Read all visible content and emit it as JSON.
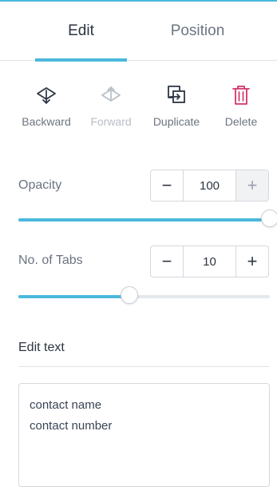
{
  "tabs": [
    {
      "label": "Edit",
      "active": true
    },
    {
      "label": "Position",
      "active": false
    }
  ],
  "toolbar": {
    "backward": {
      "label": "Backward",
      "icon": "send-backward-icon",
      "enabled": true
    },
    "forward": {
      "label": "Forward",
      "icon": "bring-forward-icon",
      "enabled": false
    },
    "duplicate": {
      "label": "Duplicate",
      "icon": "duplicate-icon",
      "enabled": true
    },
    "delete": {
      "label": "Delete",
      "icon": "trash-icon",
      "enabled": true,
      "color": "#d6336c"
    }
  },
  "opacity": {
    "label": "Opacity",
    "value": "100",
    "minus": "−",
    "plus": "+",
    "plus_disabled": true,
    "level_percent": 100
  },
  "tabs_count": {
    "label": "No. of Tabs",
    "value": "10",
    "minus": "−",
    "plus": "+",
    "level_percent": 44
  },
  "edit_text": {
    "title": "Edit text",
    "lines": [
      "contact name",
      "contact number"
    ]
  },
  "colors": {
    "accent": "#4ab8dc",
    "delete": "#d6336c",
    "text_dark": "#2b3442",
    "text_muted": "#6b7480"
  }
}
